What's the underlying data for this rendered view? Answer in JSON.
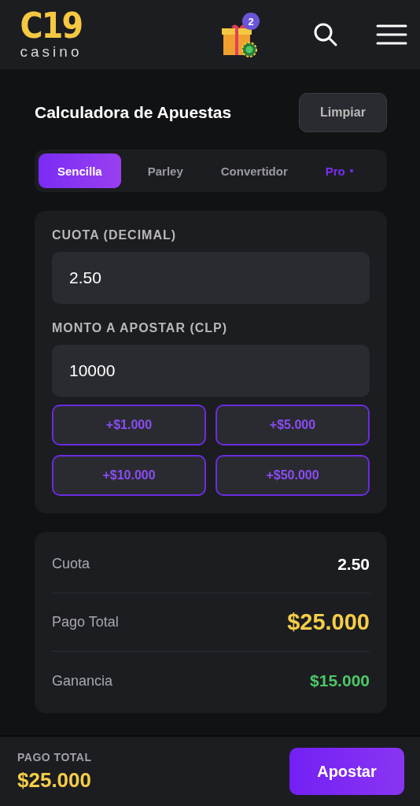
{
  "header": {
    "logo": {
      "mark": "C19",
      "word": "casino"
    },
    "gift_badge": "2"
  },
  "calculator": {
    "title": "Calculadora de Apuestas",
    "clear_button": "Limpiar",
    "tabs": [
      {
        "label": "Sencilla",
        "selected": true,
        "kind": "plain"
      },
      {
        "label": "Parley",
        "selected": false,
        "kind": "plain"
      },
      {
        "label": "Convertidor",
        "selected": false,
        "kind": "plain"
      },
      {
        "label": "Pro",
        "selected": false,
        "kind": "pro"
      }
    ],
    "fields": [
      {
        "label": "CUOTA (DECIMAL)",
        "value": "2.50"
      },
      {
        "label": "MONTO A APOSTAR (CLP)",
        "value": "10000"
      }
    ],
    "quick_amounts": [
      "+$1.000",
      "+$5.000",
      "+$10.000",
      "+$50.000"
    ],
    "results": [
      {
        "label": "Cuota",
        "value": "2.50",
        "color": "#ffffff",
        "kind": "normal"
      },
      {
        "label": "Pago Total",
        "value": "$25.000",
        "color": "#f5cd47",
        "kind": "large"
      },
      {
        "label": "Ganancia",
        "value": "$15.000",
        "color": "#4cc766",
        "kind": "normal"
      }
    ]
  },
  "footer": {
    "label": "PAGO TOTAL",
    "amount": "$25.000",
    "button": "Apostar"
  }
}
